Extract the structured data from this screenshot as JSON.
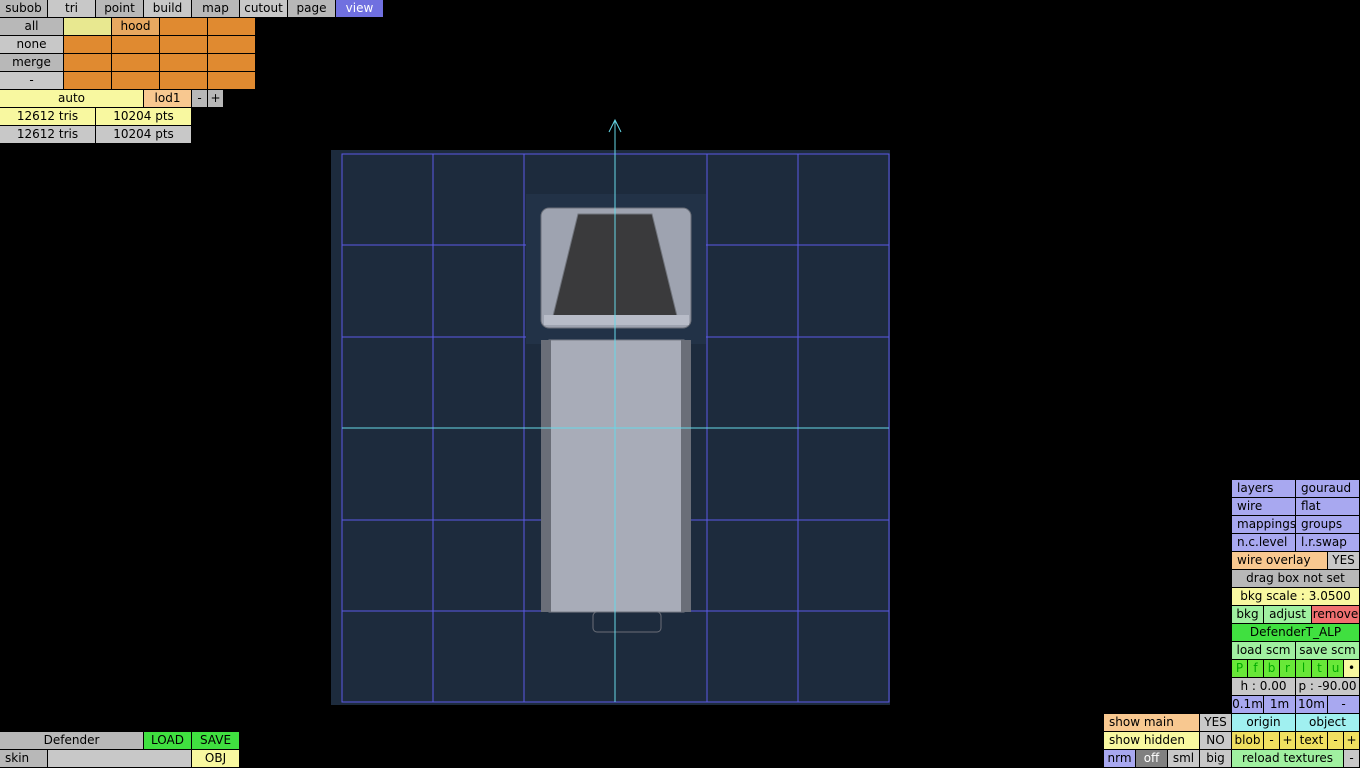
{
  "menu": {
    "tabs": [
      "subob",
      "tri",
      "point",
      "build",
      "map",
      "cutout",
      "page",
      "view"
    ]
  },
  "layers_panel": {
    "row_labels": [
      "all",
      "none",
      "merge",
      "-"
    ],
    "first_layer": "hood"
  },
  "lod": {
    "mode": "auto",
    "level": "lod1",
    "minus": "-",
    "plus": "+"
  },
  "stats": [
    {
      "tris": "12612 tris",
      "pts": "10204 pts"
    },
    {
      "tris": "12612 tris",
      "pts": "10204 pts"
    }
  ],
  "bottom_left": {
    "model_name": "Defender",
    "load": "LOAD",
    "save": "SAVE",
    "skin_label": "skin",
    "skin_value": "",
    "obj": "OBJ"
  },
  "right_panel": {
    "layers": "layers",
    "gouraud": "gouraud",
    "wire": "wire",
    "flat": "flat",
    "mappings": "mappings",
    "groups": "groups",
    "nc_level": "n.c.level",
    "lr_swap": "l.r.swap",
    "wire_overlay": "wire overlay",
    "wire_overlay_val": "YES",
    "drag_box": "drag box not set",
    "bkg_scale": "bkg scale : 3.0500",
    "bkg": "bkg",
    "adjust": "adjust",
    "remove": "remove",
    "bkg_file": "DefenderT_ALP",
    "load_scm": "load scm",
    "save_scm": "save scm",
    "views": [
      "P",
      "f",
      "b",
      "r",
      "l",
      "t",
      "u",
      "•"
    ],
    "h": "h : 0.00",
    "p": "p : -90.00",
    "grid": [
      "0.1m",
      "1m",
      "10m",
      "-"
    ],
    "show_main": "show main",
    "show_main_val": "YES",
    "origin": "origin",
    "object": "object",
    "show_hidden": "show hidden",
    "show_hidden_val": "NO",
    "blob": "blob",
    "blob_minus": "-",
    "blob_plus": "+",
    "text": "text",
    "text_minus": "-",
    "text_plus": "+",
    "nrm": "nrm",
    "off": "off",
    "sml": "sml",
    "big": "big",
    "reload": "reload textures",
    "reload_minus": "-"
  },
  "colors": {
    "viewport_bg": "#1d2b3d",
    "grid_line": "#5a5ae6",
    "axis_line": "#66d8e8"
  }
}
